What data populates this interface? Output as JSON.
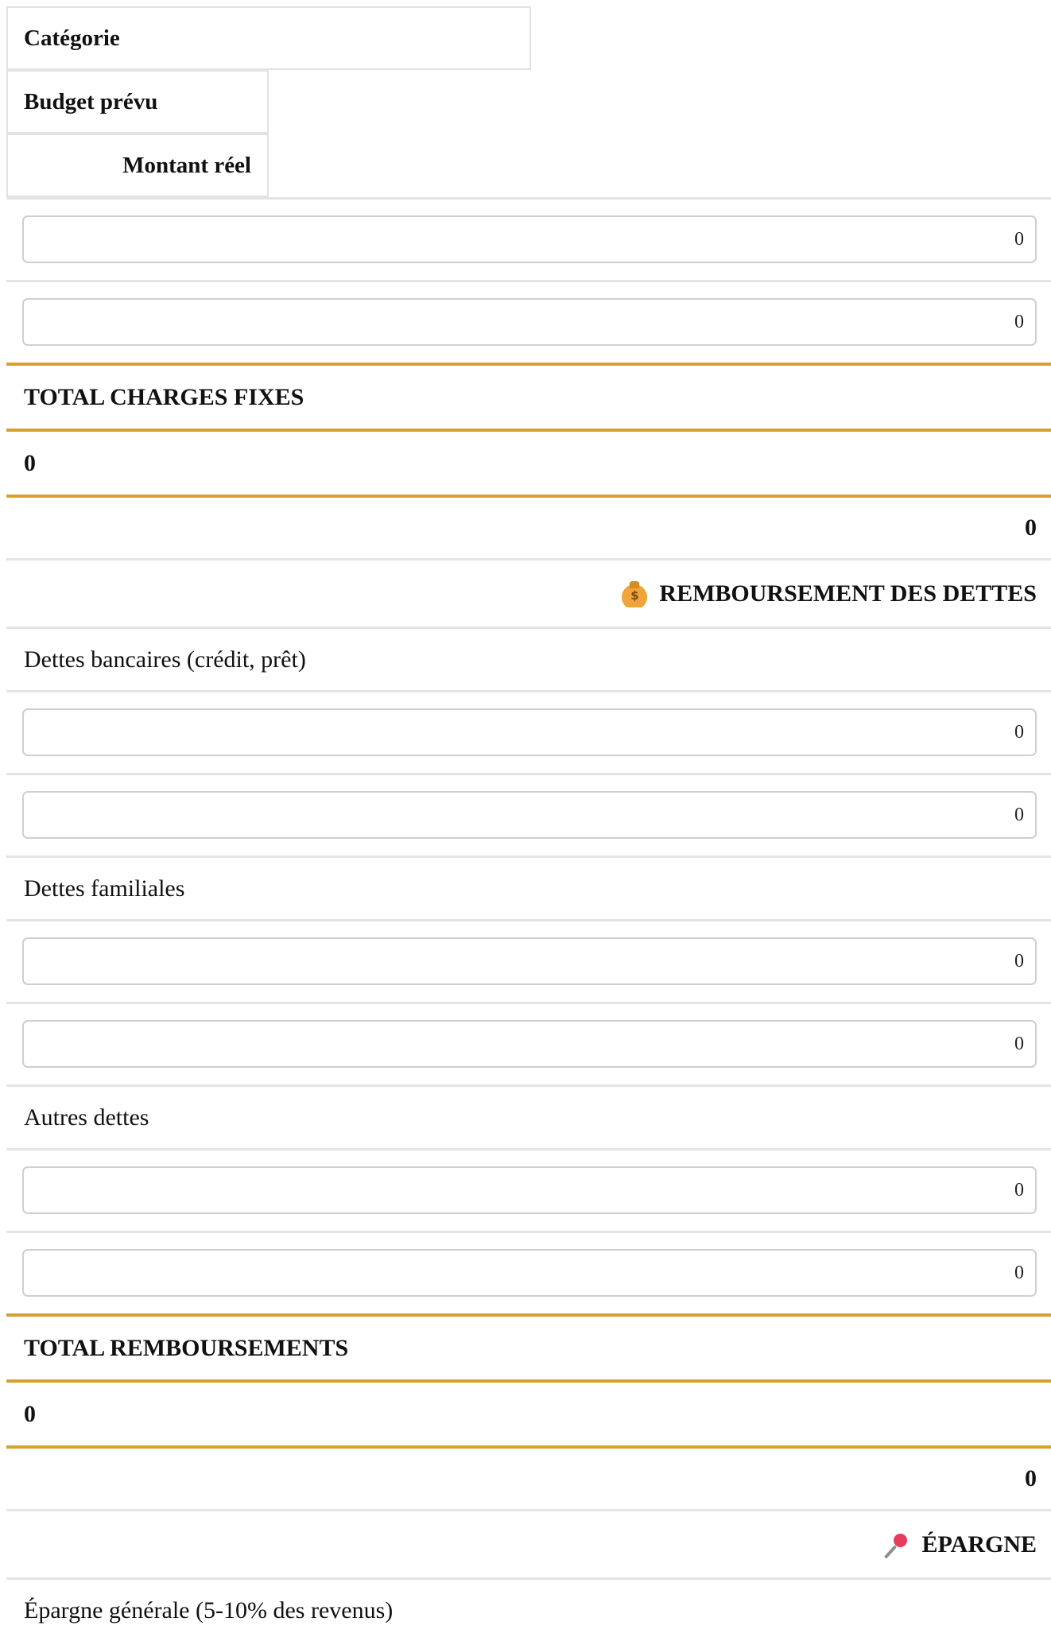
{
  "table": {
    "headers": {
      "category": "Catégorie",
      "budget": "Budget prévu",
      "actual": "Montant réel"
    },
    "inputs": {
      "default_value": "0"
    },
    "fixed_charges": {
      "total_label": "TOTAL CHARGES FIXES",
      "total_budget": "0",
      "total_actual": "0"
    },
    "debts": {
      "section_title": "REMBOURSEMENT DES DETTES",
      "section_icon": "moneybag-icon",
      "items": [
        {
          "label": "Dettes bancaires (crédit, prêt)",
          "budget": "0",
          "actual": "0"
        },
        {
          "label": "Dettes familiales",
          "budget": "0",
          "actual": "0"
        },
        {
          "label": "Autres dettes",
          "budget": "0",
          "actual": "0"
        }
      ],
      "total_label": "TOTAL REMBOURSEMENTS",
      "total_budget": "0",
      "total_actual": "0"
    },
    "savings": {
      "section_title": "ÉPARGNE",
      "section_icon": "pin-icon",
      "items": [
        {
          "label": "Épargne générale (5-10% des revenus)"
        }
      ]
    }
  },
  "colors": {
    "accent": "#d6a12c",
    "row_border": "#e4e4e4",
    "input_border": "#cfcfcf"
  }
}
